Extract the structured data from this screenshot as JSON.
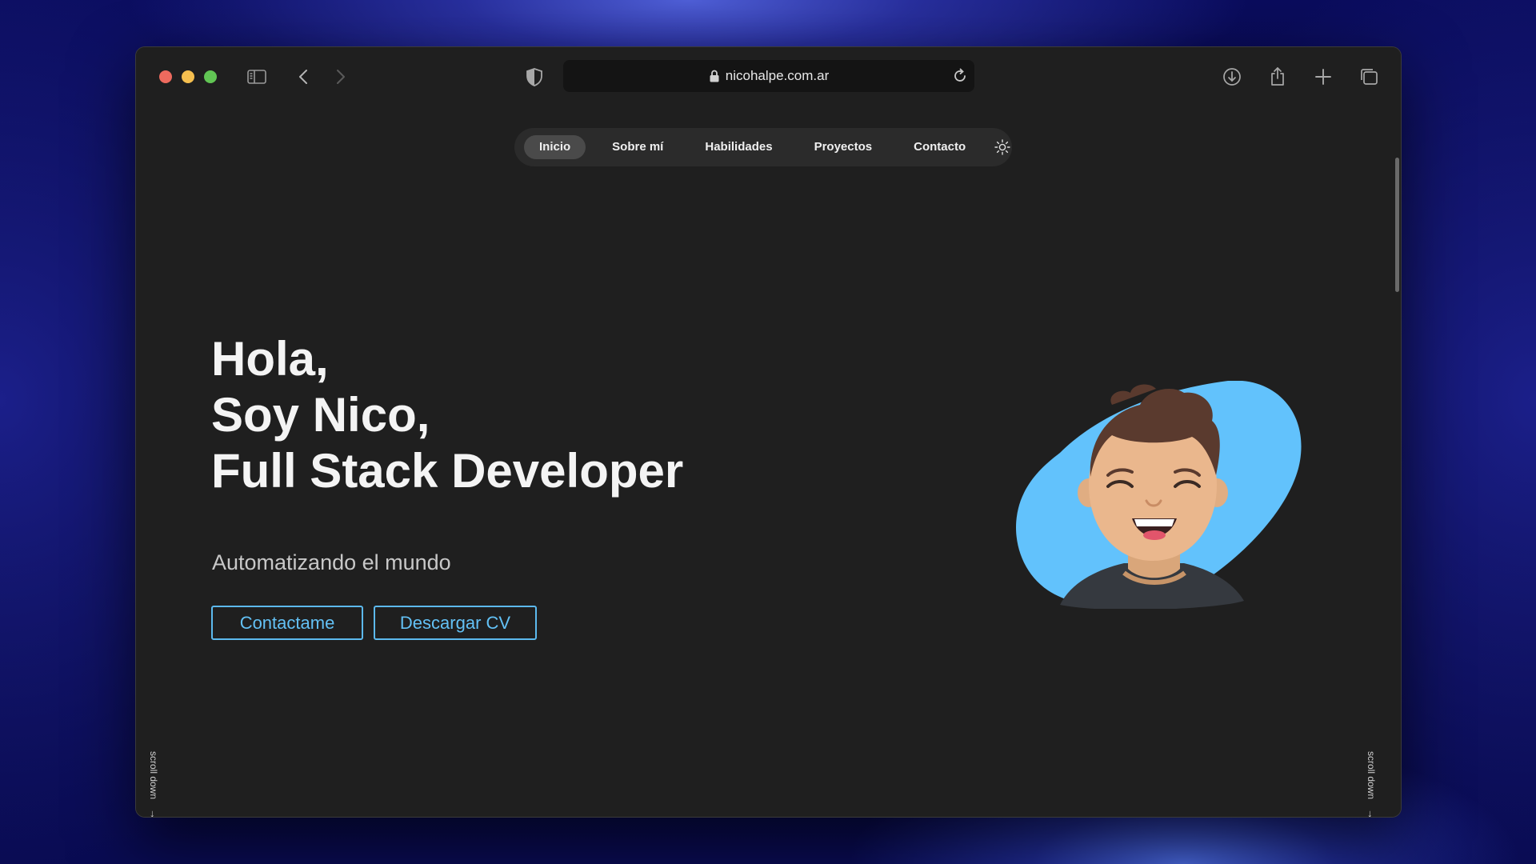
{
  "browser": {
    "url": "nicohalpe.com.ar",
    "icons": [
      "sidebar-icon",
      "back-icon",
      "forward-icon",
      "shield-icon",
      "lock-icon",
      "reload-icon",
      "download-icon",
      "share-icon",
      "new-tab-icon",
      "tabs-overview-icon"
    ]
  },
  "nav": {
    "items": [
      "Inicio",
      "Sobre mí",
      "Habilidades",
      "Proyectos",
      "Contacto"
    ],
    "active": "Inicio",
    "theme_icon": "sun-icon"
  },
  "hero": {
    "lines": [
      "Hola,",
      "Soy Nico,",
      "Full Stack Developer"
    ],
    "subtitle": "Automatizando el mundo",
    "contact_button": "Contactame",
    "cv_button": "Descargar CV"
  },
  "scroll": {
    "label": "scroll down",
    "arrow": "↓"
  },
  "colors": {
    "accent": "#5cb9ee",
    "background": "#1f1f1f",
    "avatar_blob": "#62c2fc"
  }
}
